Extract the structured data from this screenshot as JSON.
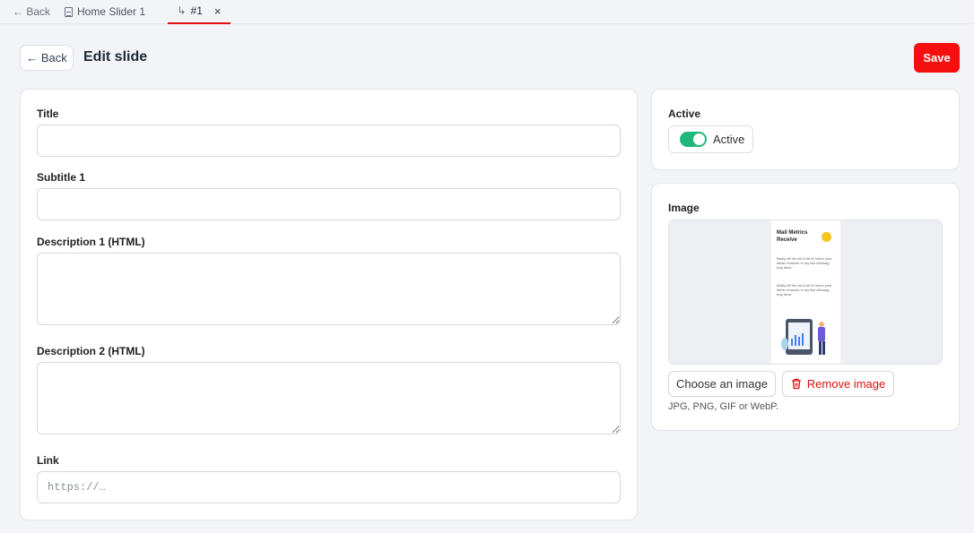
{
  "tabs": {
    "back_label": "← Back",
    "home_label": "Home Slider 1",
    "active_label": "#1",
    "close_symbol": "×"
  },
  "header": {
    "back_label": "← Back",
    "title": "Edit slide",
    "save_label": "Save"
  },
  "form": {
    "title_label": "Title",
    "title_value": "",
    "subtitle_label": "Subtitle 1",
    "subtitle_value": "",
    "desc1_label": "Description 1 (HTML)",
    "desc1_value": "",
    "desc2_label": "Description 2 (HTML)",
    "desc2_value": "",
    "link_label": "Link",
    "link_placeholder": "https://…"
  },
  "active": {
    "label": "Active",
    "toggle_label": "Active",
    "on": true,
    "color": "#1fb87a"
  },
  "image": {
    "label": "Image",
    "thumb_title": "Mail Metrics Receive",
    "thumb_text1": "Badly off his nut A bit of how's your father chancer in my flat chinwag bog drive.",
    "thumb_text2": "Badly off his nut A bit of how's your father chancer in my flat chinwag bog drive.",
    "choose_label": "Choose an image",
    "remove_label": "Remove image",
    "hint": "JPG, PNG, GIF or WebP."
  },
  "colors": {
    "save": "#f50f0f",
    "danger": "#dd1111",
    "accent_tab": "#dd1111"
  }
}
